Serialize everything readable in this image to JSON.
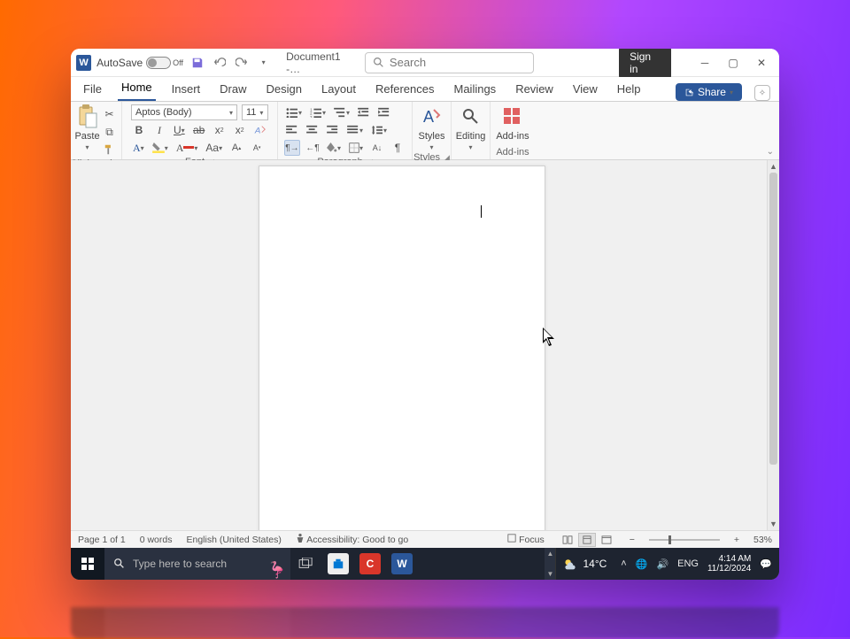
{
  "titlebar": {
    "app_initial": "W",
    "autosave_label": "AutoSave",
    "autosave_state": "Off",
    "doc_title": "Document1  -…",
    "search_placeholder": "Search",
    "signin": "Sign in"
  },
  "tabs": {
    "items": [
      "File",
      "Home",
      "Insert",
      "Draw",
      "Design",
      "Layout",
      "References",
      "Mailings",
      "Review",
      "View",
      "Help"
    ],
    "active": "Home",
    "share": "Share"
  },
  "ribbon": {
    "clipboard": {
      "paste": "Paste",
      "label": "Clipboard"
    },
    "font": {
      "name": "Aptos (Body)",
      "size": "11",
      "label": "Font",
      "change_case": "Aa"
    },
    "paragraph": {
      "label": "Paragraph"
    },
    "styles": {
      "big": "Styles",
      "label": "Styles"
    },
    "editing": {
      "big": "Editing"
    },
    "addins": {
      "big": "Add-ins",
      "label": "Add-ins"
    }
  },
  "status": {
    "page": "Page 1 of 1",
    "words": "0 words",
    "language": "English (United States)",
    "accessibility": "Accessibility: Good to go",
    "focus": "Focus",
    "zoom": "53%"
  },
  "taskbar": {
    "search_placeholder": "Type here to search",
    "weather": "14°C",
    "lang": "ENG",
    "time": "4:14 AM",
    "date": "11/12/2024",
    "word_initial": "W",
    "rec_initial": "C"
  }
}
